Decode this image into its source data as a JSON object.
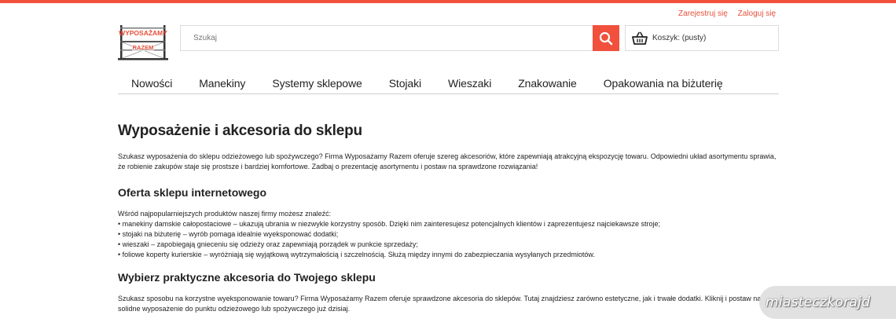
{
  "header": {
    "register_label": "Zarejestruj się",
    "login_label": "Zaloguj się",
    "logo": {
      "line1": "WYPOSAŻAMY",
      "line2": "RAZEM",
      "icon": "shelving-rack-icon"
    }
  },
  "search": {
    "placeholder": "Szukaj",
    "value": "",
    "icon": "search-icon",
    "accent": "#f0503c"
  },
  "cart": {
    "label": "Koszyk: (pusty)",
    "icon": "shopping-basket-icon"
  },
  "nav": {
    "items": [
      {
        "label": "Nowości"
      },
      {
        "label": "Manekiny"
      },
      {
        "label": "Systemy sklepowe"
      },
      {
        "label": "Stojaki"
      },
      {
        "label": "Wieszaki"
      },
      {
        "label": "Znakowanie"
      },
      {
        "label": "Opakowania na biżuterię"
      }
    ]
  },
  "main": {
    "title": "Wyposażenie i akcesoria do sklepu",
    "intro": "Szukasz wyposażenia do sklepu odzieżowego lub spożywczego? Firma Wyposażamy Razem oferuje szereg akcesoriów, które zapewniają atrakcyjną ekspozycję towaru. Odpowiedni układ asortymentu sprawia, że robienie zakupów staje się prostsze i bardziej komfortowe. Zadbaj o prezentację asortymentu i postaw na sprawdzone rozwiązania!",
    "section1_title": "Oferta sklepu internetowego",
    "section1_lead": "Wśród najpopularniejszych produktów naszej firmy możesz znaleźć:",
    "section1_items": [
      "• manekiny damskie całopostaciowe – ukazują ubrania w niezwykle korzystny sposób. Dzięki nim zainteresujesz potencjalnych klientów i zaprezentujesz najciekawsze stroje;",
      "• stojaki na biżuterię – wyrób pomaga idealnie wyeksponować dodatki;",
      "• wieszaki – zapobiegają gnieceniu się odzieży oraz zapewniają porządek w punkcie sprzedaży;",
      "• foliowe koperty kurierskie – wyróżniają się wyjątkową wytrzymałością i szczelnością. Służą między innymi do zabezpieczania wysyłanych przedmiotów."
    ],
    "section2_title": "Wybierz praktyczne akcesoria do Twojego sklepu",
    "section2_text": "Szukasz sposobu na korzystne wyeksponowanie towaru? Firma Wyposażamy Razem oferuje sprawdzone akcesoria do sklepów. Tutaj znajdziesz zarówno estetyczne, jak i trwałe dodatki. Kliknij i postaw na solidne wyposażenie do punktu odzieżowego lub spożywczego już dzisiaj."
  },
  "watermark": {
    "text": "miasteczkorajd"
  }
}
